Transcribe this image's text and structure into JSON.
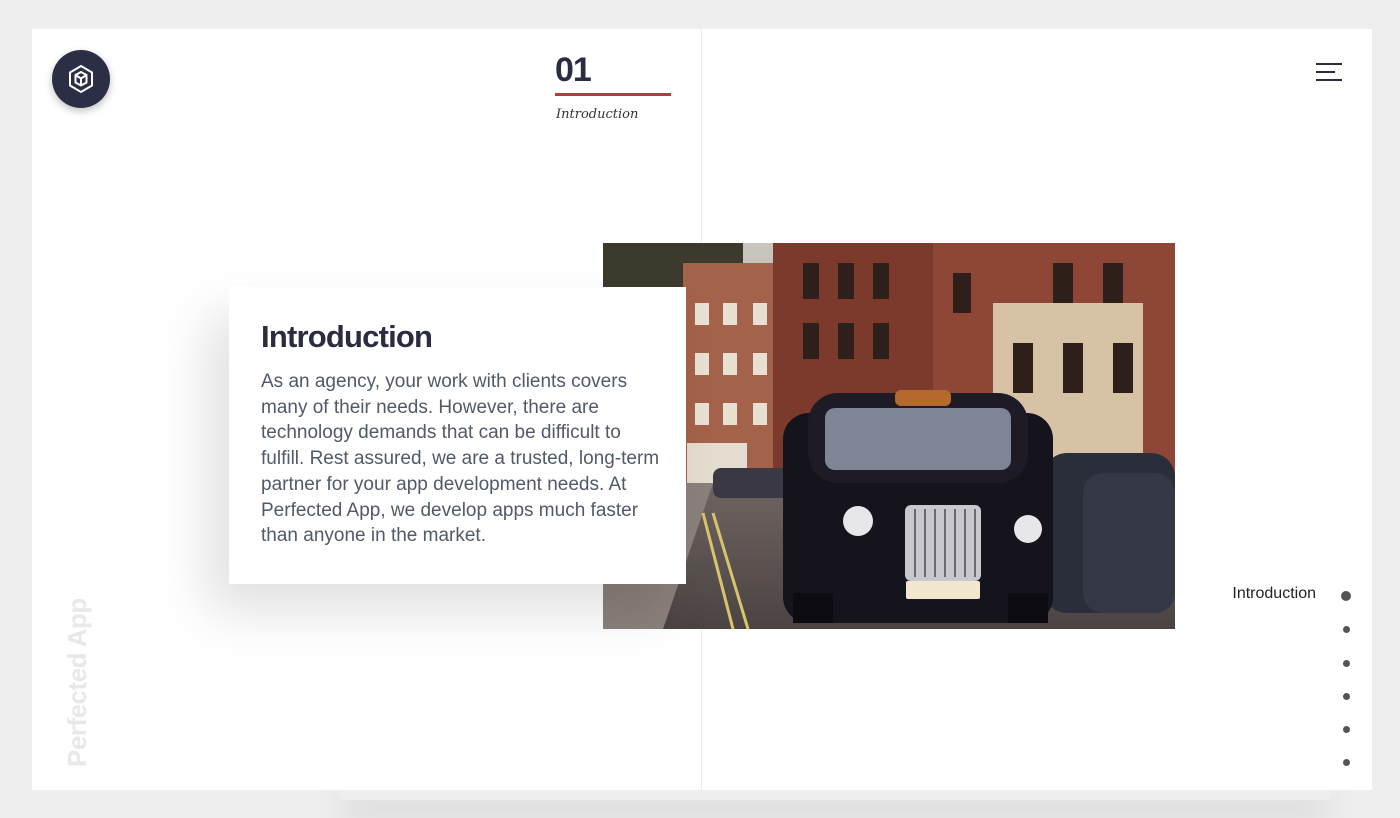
{
  "header": {
    "section_number": "01",
    "section_caption": "Introduction"
  },
  "intro_card": {
    "title": "Introduction",
    "body": "As an agency, your work with clients covers many of their needs. However, there are technology demands that can be difficult to fulfill. Rest assured, we are a trusted, long-term partner for your app development needs. At Perfected App, we develop apps much faster than anyone in the market."
  },
  "brand": {
    "vertical_name": "Perfected App"
  },
  "side_nav": {
    "active_label": "Introduction",
    "dot_count": 6
  },
  "icons": {
    "logo": "hexagon-cube-icon",
    "menu": "hamburger-menu-icon"
  },
  "colors": {
    "navy": "#2c2e45",
    "accent_red": "#c0363f",
    "vertical_text": "#e8e8e8"
  }
}
